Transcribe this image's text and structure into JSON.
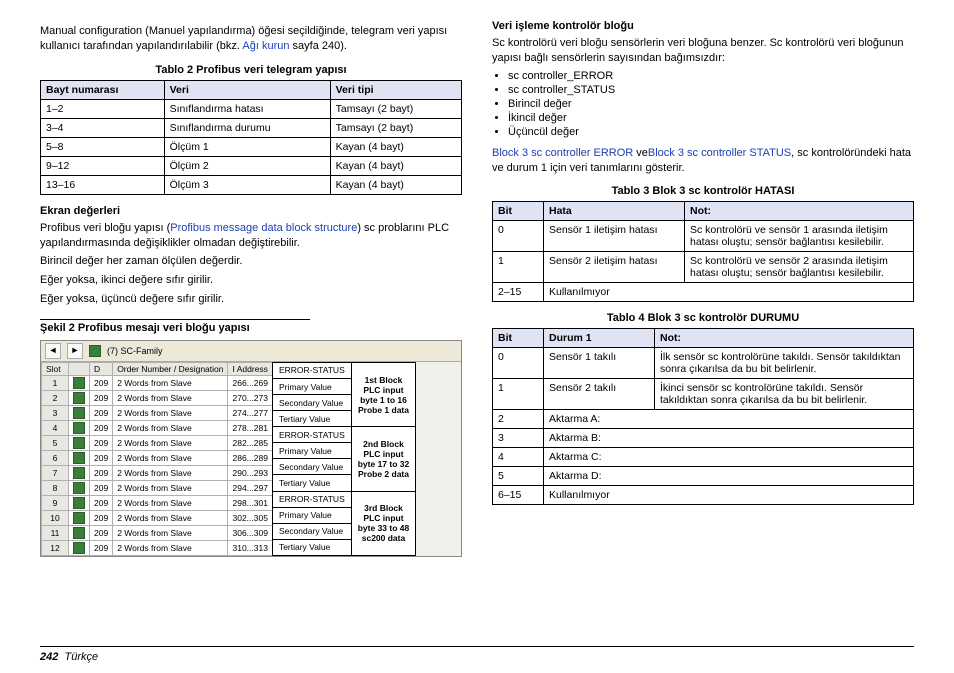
{
  "left": {
    "intro": "Manual configuration (Manuel yapılandırma) öğesi seçildiğinde, telegram veri yapısı kullanıcı tarafından yapılandırılabilir (bkz. ",
    "intro_link": "Ağı kurun",
    "intro_after": "sayfa 240).",
    "table2_title": "Tablo 2  Profibus veri telegram yapısı",
    "table2_headers": [
      "Bayt numarası",
      "Veri",
      "Veri tipi"
    ],
    "table2_rows": [
      [
        "1–2",
        "Sınıflandırma hatası",
        "Tamsayı (2 bayt)"
      ],
      [
        "3–4",
        "Sınıflandırma durumu",
        "Tamsayı (2 bayt)"
      ],
      [
        "5–8",
        "Ölçüm 1",
        "Kayan (4 bayt)"
      ],
      [
        "9–12",
        "Ölçüm 2",
        "Kayan (4 bayt)"
      ],
      [
        "13–16",
        "Ölçüm 3",
        "Kayan (4 bayt)"
      ]
    ],
    "h_screen": "Ekran değerleri",
    "p_screen1a": "Profibus veri bloğu yapısı (",
    "p_screen1_link": "Profibus message data block structure",
    "p_screen1b": ") sc problarını PLC yapılandırmasında değişiklikler olmadan değiştirebilir.",
    "p_screen2": "Birincil değer her zaman ölçülen değerdir.",
    "p_screen3": "Eğer yoksa, ikinci değere sıfır girilir.",
    "p_screen4": "Eğer yoksa, üçüncü değere sıfır girilir.",
    "fig_title": "Şekil 2  Profibus mesajı veri bloğu yapısı",
    "fig": {
      "top_label": "(7) SC-Family",
      "headers": [
        "Slot",
        "",
        "D",
        "Order Number / Designation",
        "I Address"
      ],
      "rows": [
        [
          "1",
          "",
          "209",
          "2 Words from Slave",
          "266...269"
        ],
        [
          "2",
          "",
          "209",
          "2 Words from Slave",
          "270...273"
        ],
        [
          "3",
          "",
          "209",
          "2 Words from Slave",
          "274...277"
        ],
        [
          "4",
          "",
          "209",
          "2 Words from Slave",
          "278...281"
        ],
        [
          "5",
          "",
          "209",
          "2 Words from Slave",
          "282...285"
        ],
        [
          "6",
          "",
          "209",
          "2 Words from Slave",
          "286...289"
        ],
        [
          "7",
          "",
          "209",
          "2 Words from Slave",
          "290...293"
        ],
        [
          "8",
          "",
          "209",
          "2 Words from Slave",
          "294...297"
        ],
        [
          "9",
          "",
          "209",
          "2 Words from Slave",
          "298...301"
        ],
        [
          "10",
          "",
          "209",
          "2 Words from Slave",
          "302...305"
        ],
        [
          "11",
          "",
          "209",
          "2 Words from Slave",
          "306...309"
        ],
        [
          "12",
          "",
          "209",
          "2 Words from Slave",
          "310...313"
        ]
      ],
      "annot_groups": [
        {
          "items": [
            "ERROR-STATUS",
            "Primary Value",
            "Secondary Value",
            "Tertiary Value"
          ],
          "note": "1st Block\nPLC input\nbyte 1 to 16\nProbe 1 data"
        },
        {
          "items": [
            "ERROR-STATUS",
            "Primary Value",
            "Secondary Value",
            "Tertiary Value"
          ],
          "note": "2nd Block\nPLC input\nbyte 17 to 32\nProbe 2 data"
        },
        {
          "items": [
            "ERROR-STATUS",
            "Primary Value",
            "Secondary Value",
            "Tertiary Value"
          ],
          "note": "3rd Block\nPLC input\nbyte 33 to 48\nsc200 data"
        }
      ]
    }
  },
  "right": {
    "h1": "Veri işleme kontrolör bloğu",
    "p1": "Sc kontrolörü veri bloğu sensörlerin veri bloğuna benzer. Sc kontrolörü veri bloğunun yapısı bağlı sensörlerin sayısından bağımsızdır:",
    "bullets": [
      "sc controller_ERROR",
      "sc controller_STATUS",
      "Birincil değer",
      "İkincil değer",
      "Üçüncül değer"
    ],
    "p2_link1": "Block 3 sc controller ERROR",
    "p2_mid": " ve",
    "p2_link2": "Block 3 sc controller STATUS",
    "p2_after": ", sc kontrolöründeki hata ve durum 1 için veri tanımlarını gösterir.",
    "table3_title": "Tablo 3  Blok 3 sc kontrolör HATASI",
    "table3_headers": [
      "Bit",
      "Hata",
      "Not:"
    ],
    "table3_rows": [
      [
        "0",
        "Sensör 1 iletişim hatası",
        "Sc kontrolörü ve sensör 1 arasında iletişim hatası oluştu; sensör bağlantısı kesilebilir."
      ],
      [
        "1",
        "Sensör 2 iletişim hatası",
        "Sc kontrolörü ve sensör 2 arasında iletişim hatası oluştu; sensör bağlantısı kesilebilir."
      ],
      [
        "2–15",
        "Kullanılmıyor",
        ""
      ]
    ],
    "table4_title": "Tablo 4  Blok 3 sc kontrolör DURUMU",
    "table4_headers": [
      "Bit",
      "Durum 1",
      "Not:"
    ],
    "table4_rows": [
      [
        "0",
        "Sensör 1 takılı",
        "İlk sensör sc kontrolörüne takıldı. Sensör takıldıktan sonra çıkarılsa da bu bit belirlenir."
      ],
      [
        "1",
        "Sensör 2 takılı",
        "İkinci sensör sc kontrolörüne takıldı. Sensör takıldıktan sonra çıkarılsa da bu bit belirlenir."
      ],
      [
        "2",
        "Aktarma A:",
        ""
      ],
      [
        "3",
        "Aktarma B:",
        ""
      ],
      [
        "4",
        "Aktarma C:",
        ""
      ],
      [
        "5",
        "Aktarma D:",
        ""
      ],
      [
        "6–15",
        "Kullanılmıyor",
        ""
      ]
    ]
  },
  "footer": {
    "page": "242",
    "lang": "Türkçe"
  }
}
